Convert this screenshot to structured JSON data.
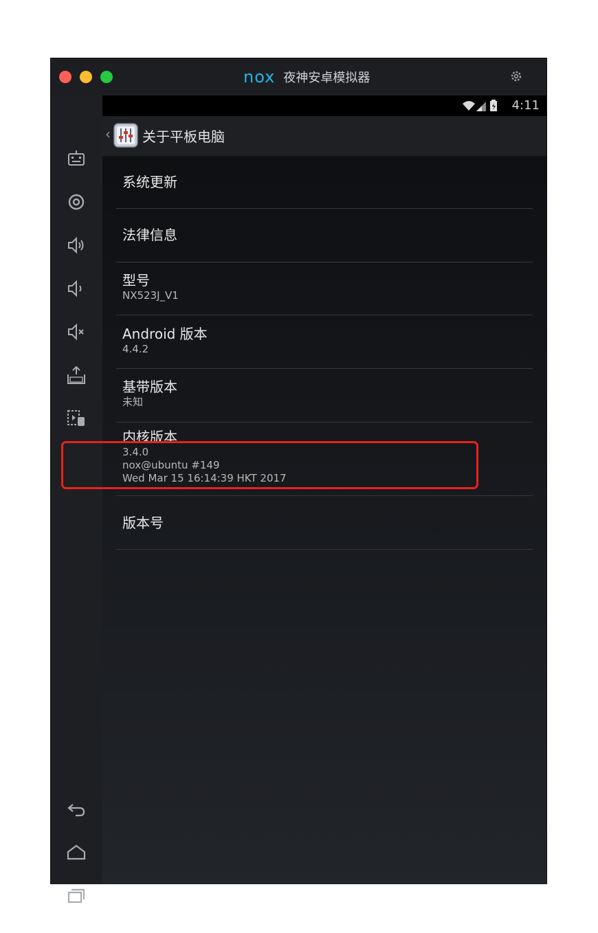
{
  "window": {
    "brand_logo": "nox",
    "brand_name": "夜神安卓模拟器"
  },
  "colors": {
    "accent": "#25b3e6",
    "highlight": "#e8231b",
    "traffic_close": "#fc5f57",
    "traffic_min": "#fdbc2e",
    "traffic_max": "#28c840"
  },
  "sidebar": {
    "icons": [
      "keyboard-icon",
      "location-icon",
      "volume-up-icon",
      "volume-down-icon",
      "mute-icon",
      "apk-install-icon",
      "screenshot-icon",
      "back-icon",
      "home-icon",
      "recents-icon"
    ]
  },
  "status_bar": {
    "time": "4:11",
    "icons": [
      "wifi-icon",
      "signal-icon",
      "battery-icon"
    ]
  },
  "action_bar": {
    "back": "‹",
    "title": "关于平板电脑"
  },
  "settings": [
    {
      "title": "系统更新"
    },
    {
      "title": "法律信息"
    },
    {
      "title": "型号",
      "subtitle": [
        "NX523J_V1"
      ]
    },
    {
      "title": "Android 版本",
      "subtitle": [
        "4.4.2"
      ]
    },
    {
      "title": "基带版本",
      "subtitle": [
        "未知"
      ]
    },
    {
      "title": "内核版本",
      "subtitle": [
        "3.4.0",
        "nox@ubuntu #149",
        "Wed Mar 15 16:14:39 HKT 2017"
      ]
    },
    {
      "title": "版本号"
    }
  ]
}
